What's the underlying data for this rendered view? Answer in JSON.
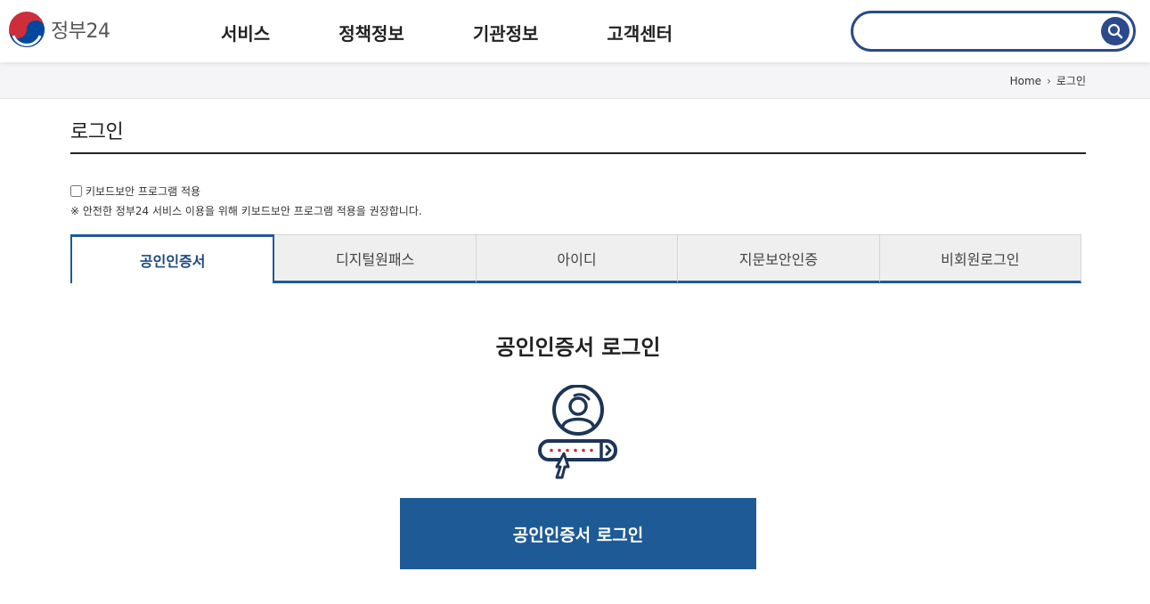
{
  "header": {
    "logo_text": "정부24",
    "nav": [
      {
        "label": "서비스"
      },
      {
        "label": "정책정보"
      },
      {
        "label": "기관정보"
      },
      {
        "label": "고객센터"
      }
    ],
    "search": {
      "value": "",
      "placeholder": ""
    }
  },
  "breadcrumb": {
    "home": "Home",
    "current": "로그인"
  },
  "page": {
    "title": "로그인"
  },
  "keyboard_security": {
    "label": "키보드보안 프로그램 적용",
    "checked": false,
    "note": "※ 안전한 정부24 서비스 이용을 위해 키보드보안 프로그램 적용을 권장합니다."
  },
  "tabs": [
    {
      "label": "공인인증서",
      "active": true
    },
    {
      "label": "디지털원패스",
      "active": false
    },
    {
      "label": "아이디",
      "active": false
    },
    {
      "label": "지문보안인증",
      "active": false
    },
    {
      "label": "비회원로그인",
      "active": false
    }
  ],
  "content": {
    "title": "공인인증서 로그인",
    "button_label": "공인인증서 로그인",
    "icon": "certificate-login-icon"
  },
  "colors": {
    "primary": "#1e5a96",
    "search_border": "#2b4a8c",
    "icon_navy": "#1d3557",
    "icon_dot_red": "#d6283a"
  }
}
